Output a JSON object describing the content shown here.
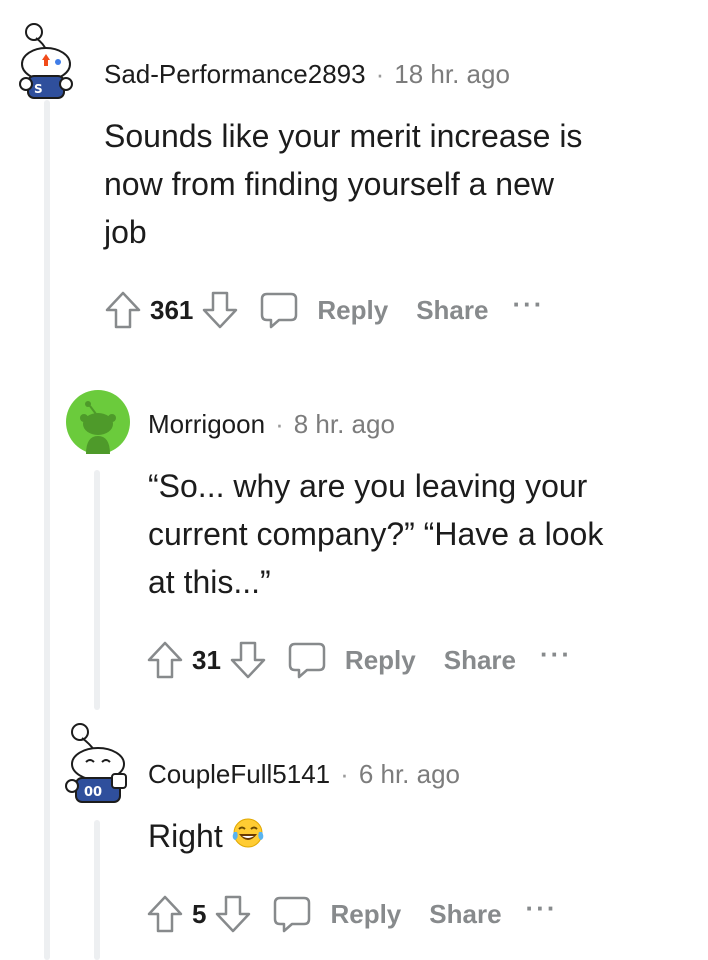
{
  "comments": [
    {
      "author": "Sad-Performance2893",
      "separator": "·",
      "time": "18 hr. ago",
      "body_lines": [
        "Sounds like your merit increase is",
        "now from finding yourself a new",
        "job"
      ],
      "score": "361",
      "reply_label": "Reply",
      "share_label": "Share",
      "more_label": "···"
    },
    {
      "author": "Morrigoon",
      "separator": "·",
      "time": "8 hr. ago",
      "body_lines": [
        "“So... why are you leaving your",
        "current company?” “Have a look",
        "at this...”"
      ],
      "score": "31",
      "reply_label": "Reply",
      "share_label": "Share",
      "more_label": "···"
    },
    {
      "author": "CoupleFull5141",
      "separator": "·",
      "time": "6 hr. ago",
      "body_lines": [
        "Right"
      ],
      "score": "5",
      "reply_label": "Reply",
      "share_label": "Share",
      "more_label": "···"
    }
  ],
  "colors": {
    "upvote": "#f14b1a",
    "avatar_green": "#6bcb3c",
    "avatar_blue": "#2f4f9c",
    "icon_gray": "#878a8c",
    "thread_line": "#edeff1"
  },
  "icons": {
    "upvote": "arrow-up-icon",
    "downvote": "arrow-down-icon",
    "reply": "speech-bubble-icon",
    "emoji": "tears-of-joy-emoji"
  }
}
